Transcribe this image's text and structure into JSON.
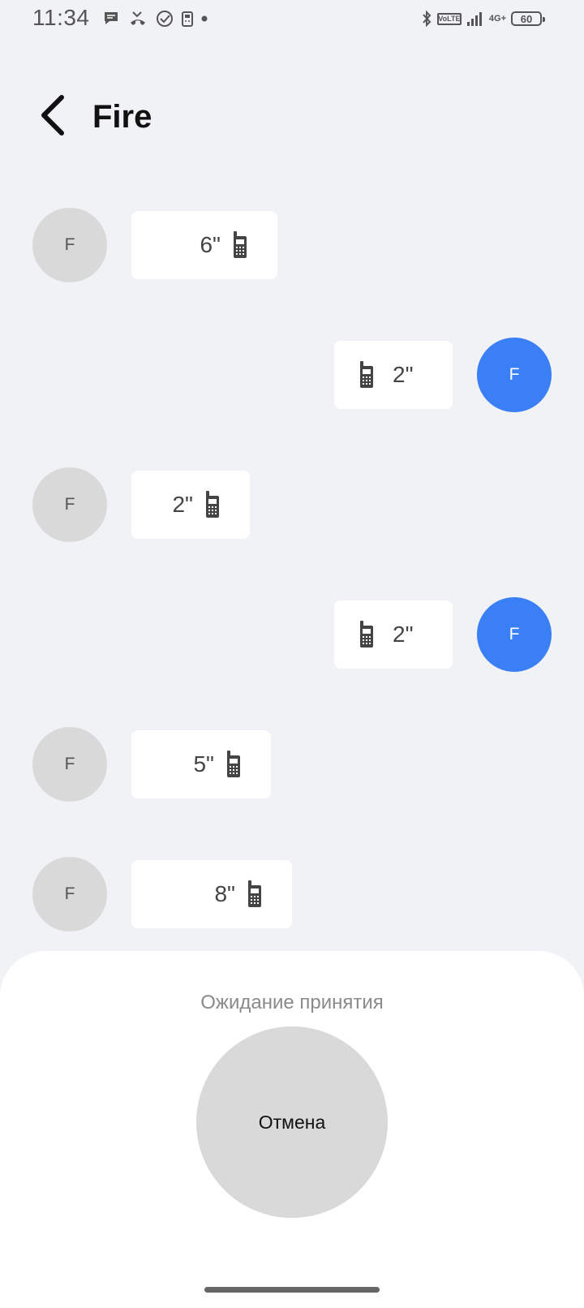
{
  "status_bar": {
    "time": "11:34",
    "left_icons": [
      "chat-bubble-icon",
      "missed-call-icon",
      "check-circle-icon",
      "phone-icon",
      "dot-icon"
    ],
    "right_icons": [
      "bluetooth-icon",
      "volte-icon",
      "signal-icon",
      "4g-plus-icon",
      "battery-icon"
    ],
    "volte_label_top": "Vo",
    "volte_label_bottom": "LTE",
    "network": "4G+",
    "battery_level": "60"
  },
  "header": {
    "title": "Fire"
  },
  "messages": [
    {
      "direction": "incoming",
      "avatar": "F",
      "duration": "6\""
    },
    {
      "direction": "outgoing",
      "avatar": "F",
      "duration": "2\""
    },
    {
      "direction": "incoming",
      "avatar": "F",
      "duration": "2\""
    },
    {
      "direction": "outgoing",
      "avatar": "F",
      "duration": "2\""
    },
    {
      "direction": "incoming",
      "avatar": "F",
      "duration": "5\""
    },
    {
      "direction": "incoming",
      "avatar": "F",
      "duration": "8\""
    }
  ],
  "bottom_sheet": {
    "status_text": "Ожидание принятия",
    "cancel_label": "Отмена"
  },
  "colors": {
    "background": "#f1f2f5",
    "outgoing_avatar": "#3a7ff5",
    "incoming_avatar": "#d9d9d9",
    "bubble": "#ffffff"
  }
}
